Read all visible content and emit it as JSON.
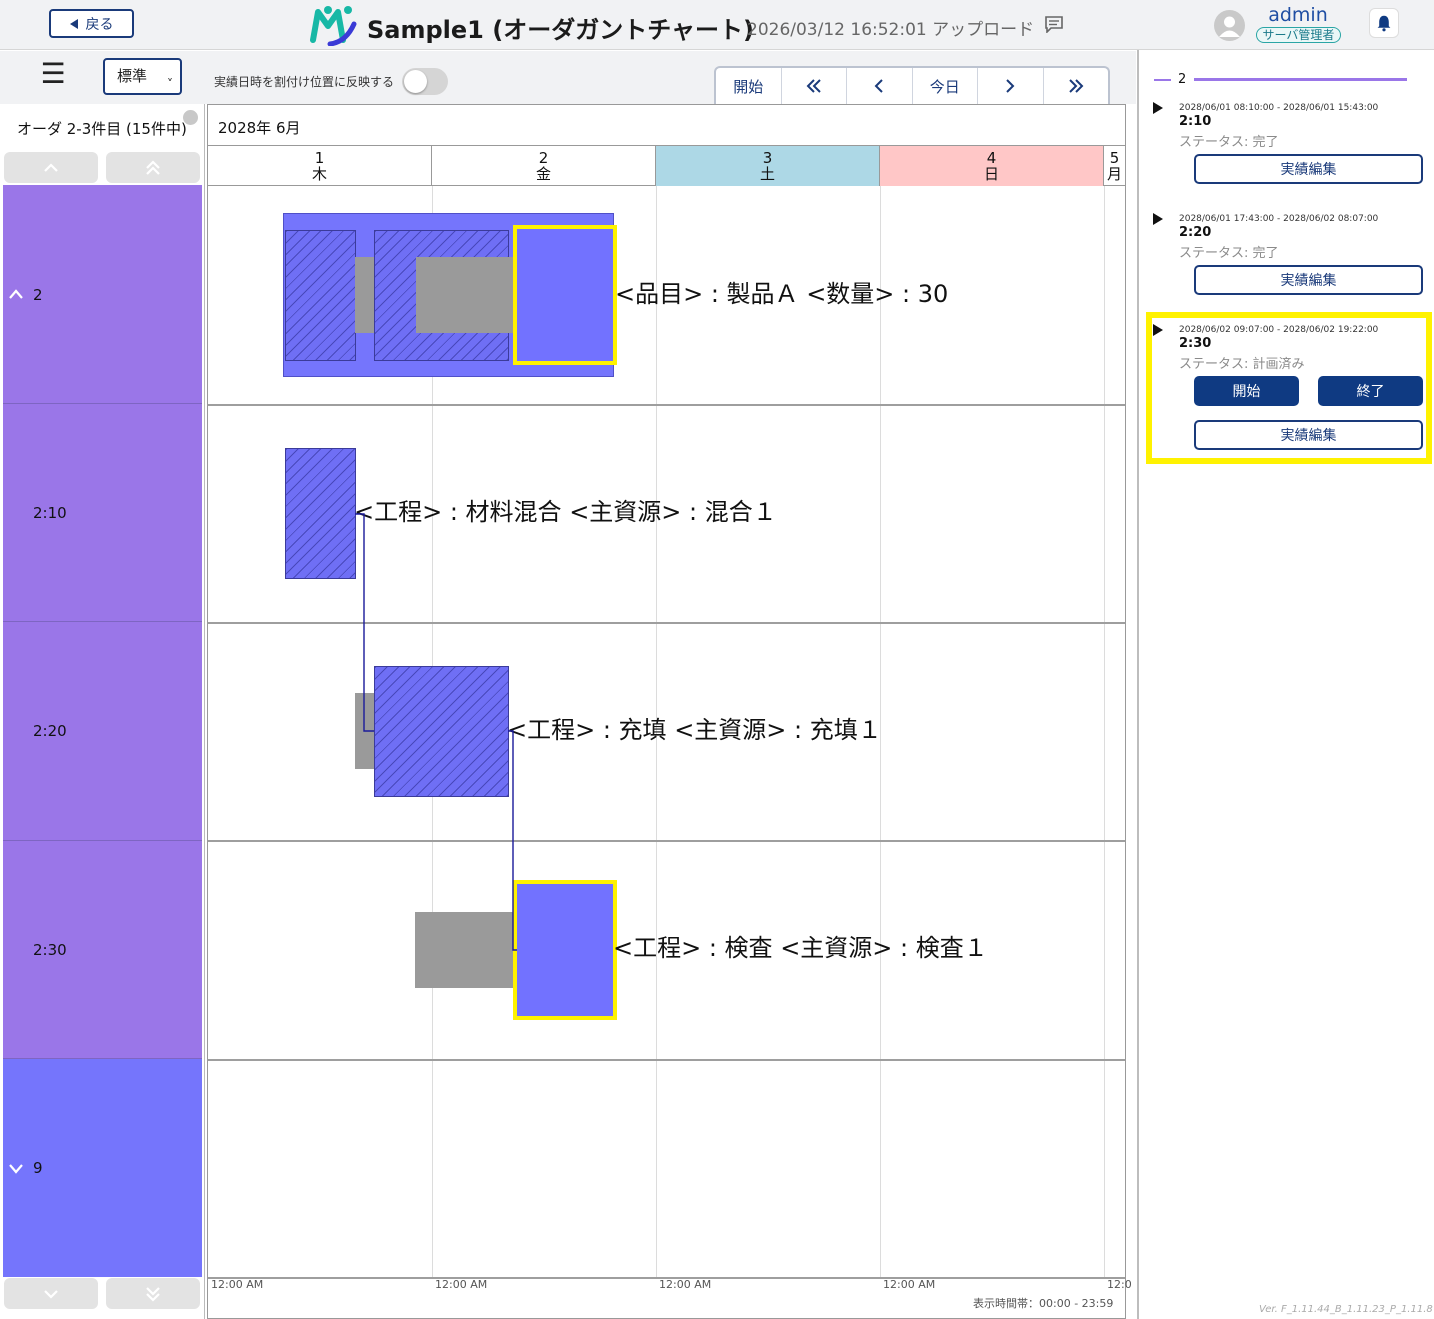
{
  "header": {
    "back_label": "戻る",
    "title": "Sample1 (オーダガントチャート)",
    "upload_info": "2026/03/12 16:52:01 アップロード",
    "user_name": "admin",
    "user_role": "サーバ管理者"
  },
  "toolbar": {
    "menu_glyph": "☰",
    "view_mode": "標準",
    "reflect_label": "実績日時を割付け位置に反映する",
    "reflect_on": false,
    "nav": {
      "start": "開始",
      "today": "今日"
    }
  },
  "left_panel": {
    "order_count": "オーダ 2-3件目 (15件中)",
    "rows": [
      {
        "label": "2",
        "expanded": true
      },
      {
        "label": "2:10"
      },
      {
        "label": "2:20"
      },
      {
        "label": "2:30"
      },
      {
        "label": "9",
        "expanded": false
      }
    ]
  },
  "gantt": {
    "month": "2028年 6月",
    "days": [
      {
        "day": "1",
        "weekday": "木"
      },
      {
        "day": "2",
        "weekday": "金"
      },
      {
        "day": "3",
        "weekday": "土"
      },
      {
        "day": "4",
        "weekday": "日"
      },
      {
        "day": "5",
        "weekday": "月"
      }
    ],
    "row_labels": [
      "<品目> : 製品Ａ <数量> : 30",
      "<工程> : 材料混合 <主資源> : 混合１",
      "<工程> : 充填 <主資源> : 充填１",
      "<工程> : 検査 <主資源> : 検査１"
    ],
    "axis_ticks": [
      "12:00 AM",
      "12:00 AM",
      "12:00 AM",
      "12:00 AM",
      "12:0"
    ],
    "time_range": "表示時間帯：00:00 - 23:59"
  },
  "right_panel": {
    "order": "2",
    "cards": [
      {
        "datetime": "2028/06/01 08:10:00 - 2028/06/01 15:43:00",
        "code": "2:10",
        "status": "ステータス: 完了",
        "edit_label": "実績編集"
      },
      {
        "datetime": "2028/06/01 17:43:00 - 2028/06/02 08:07:00",
        "code": "2:20",
        "status": "ステータス: 完了",
        "edit_label": "実績編集"
      },
      {
        "datetime": "2028/06/02 09:07:00 - 2028/06/02 19:22:00",
        "code": "2:30",
        "status": "ステータス: 計画済み",
        "start_label": "開始",
        "end_label": "終了",
        "edit_label": "実績編集"
      }
    ],
    "version": "Ver. F_1.11.44_B_1.11.23_P_1.11.8"
  },
  "colors": {
    "row_purple": "#9a76e8",
    "row_blue": "#7575fc",
    "saturday": "#add8e6",
    "sunday": "#ffc7c7",
    "selection": "#fff200",
    "primary": "#0f3a82"
  }
}
